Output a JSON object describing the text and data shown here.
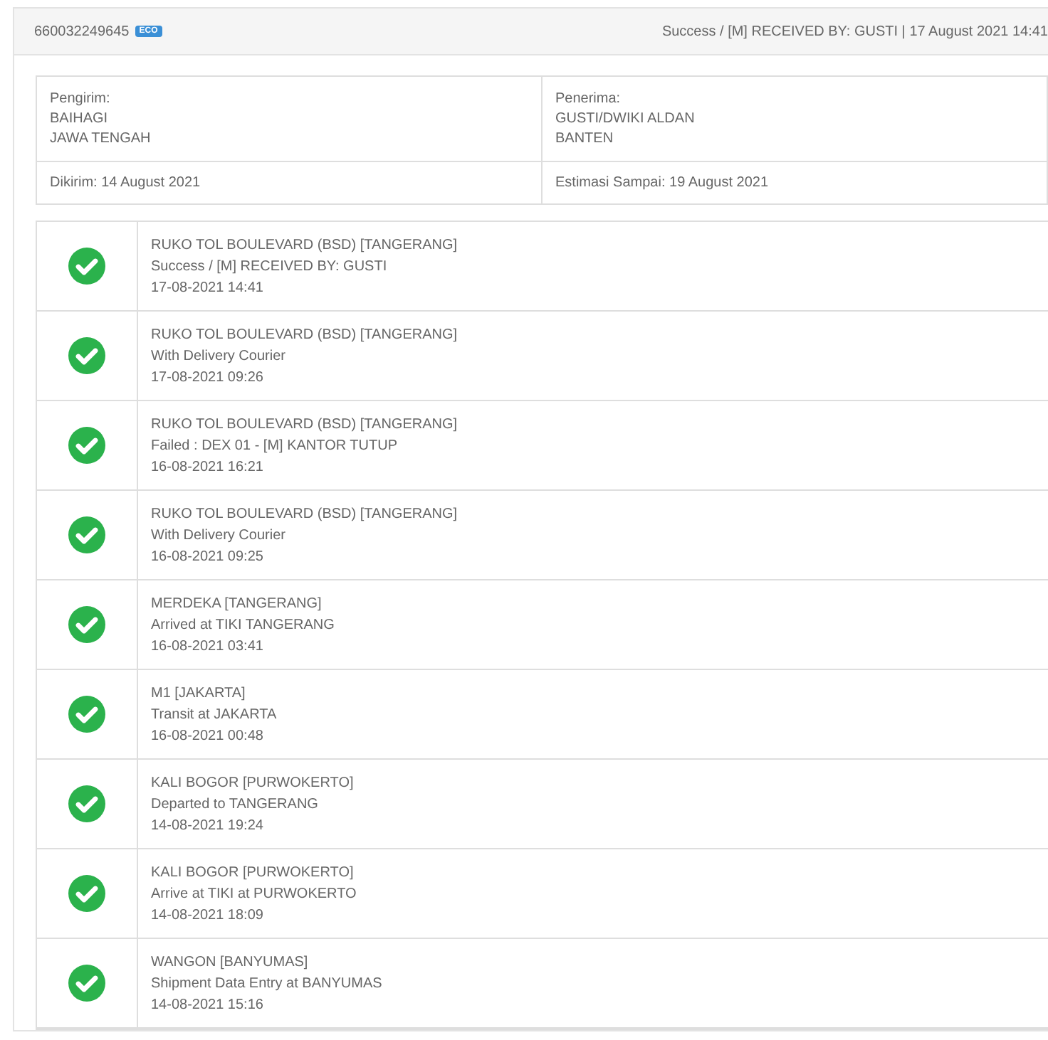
{
  "header": {
    "awb": "660032249645",
    "service_badge": "ECO",
    "status": "Success / [M] RECEIVED BY: GUSTI | 17 August 2021 14:41"
  },
  "info": {
    "sender": {
      "label": "Pengirim:",
      "name": "BAIHAGI",
      "region": "JAWA TENGAH"
    },
    "receiver": {
      "label": "Penerima:",
      "name": "GUSTI/DWIKI ALDAN",
      "region": "BANTEN"
    },
    "sent": "Dikirim: 14 August 2021",
    "estimate": "Estimasi Sampai: 19 August 2021"
  },
  "history": [
    {
      "location": "RUKO TOL BOULEVARD (BSD) [TANGERANG]",
      "description": "Success / [M] RECEIVED BY: GUSTI",
      "time": "17-08-2021 14:41"
    },
    {
      "location": "RUKO TOL BOULEVARD (BSD) [TANGERANG]",
      "description": "With Delivery Courier",
      "time": "17-08-2021 09:26"
    },
    {
      "location": "RUKO TOL BOULEVARD (BSD) [TANGERANG]",
      "description": "Failed : DEX 01 - [M] KANTOR TUTUP",
      "time": "16-08-2021 16:21"
    },
    {
      "location": "RUKO TOL BOULEVARD (BSD) [TANGERANG]",
      "description": "With Delivery Courier",
      "time": "16-08-2021 09:25"
    },
    {
      "location": "MERDEKA [TANGERANG]",
      "description": "Arrived at TIKI TANGERANG",
      "time": "16-08-2021 03:41"
    },
    {
      "location": "M1 [JAKARTA]",
      "description": "Transit at JAKARTA",
      "time": "16-08-2021 00:48"
    },
    {
      "location": "KALI BOGOR [PURWOKERTO]",
      "description": "Departed to TANGERANG",
      "time": "14-08-2021 19:24"
    },
    {
      "location": "KALI BOGOR [PURWOKERTO]",
      "description": "Arrive at TIKI at PURWOKERTO",
      "time": "14-08-2021 18:09"
    },
    {
      "location": "WANGON [BANYUMAS]",
      "description": "Shipment Data Entry at BANYUMAS",
      "time": "14-08-2021 15:16"
    }
  ]
}
